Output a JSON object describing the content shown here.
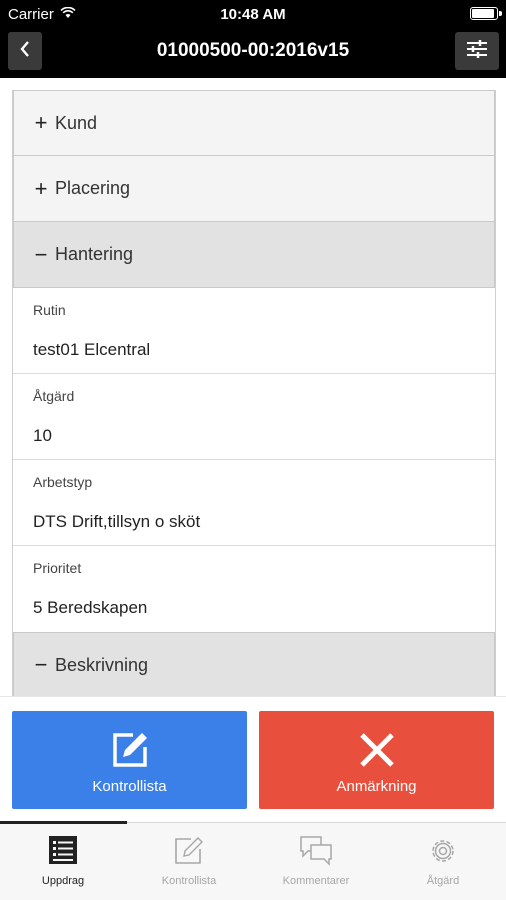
{
  "status_bar": {
    "carrier": "Carrier",
    "time": "10:48 AM"
  },
  "nav": {
    "title": "01000500-00:2016v15",
    "back_icon": "chevron-left-icon",
    "filter_icon": "sliders-icon"
  },
  "sections": {
    "kund": {
      "symbol": "+",
      "label": "Kund"
    },
    "placering": {
      "symbol": "+",
      "label": "Placering"
    },
    "hantering": {
      "symbol": "−",
      "label": "Hantering"
    },
    "beskrivning": {
      "symbol": "−",
      "label": "Beskrivning"
    }
  },
  "fields": [
    {
      "label": "Rutin",
      "value": "test01 Elcentral"
    },
    {
      "label": "Åtgärd",
      "value": "10"
    },
    {
      "label": "Arbetstyp",
      "value": "DTS Drift,tillsyn o sköt"
    },
    {
      "label": "Prioritet",
      "value": "5 Beredskapen"
    }
  ],
  "actions": {
    "kontrollista": {
      "label": "Kontrollista",
      "color": "#3b7fe8",
      "icon": "edit-icon"
    },
    "anmarkning": {
      "label": "Anmärkning",
      "color": "#e84f3c",
      "icon": "close-icon"
    }
  },
  "tabs": [
    {
      "label": "Uppdrag",
      "icon": "list-icon",
      "active": true
    },
    {
      "label": "Kontrollista",
      "icon": "edit-icon",
      "active": false
    },
    {
      "label": "Kommentarer",
      "icon": "chat-icon",
      "active": false
    },
    {
      "label": "Åtgärd",
      "icon": "gear-icon",
      "active": false
    }
  ]
}
